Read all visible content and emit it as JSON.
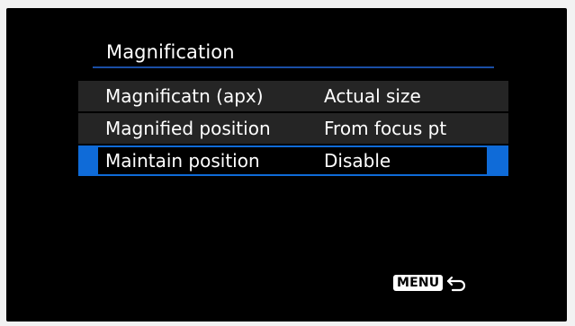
{
  "header": {
    "title": "Magnification"
  },
  "menu": {
    "items": [
      {
        "label": "Magnificatn (apx)",
        "value": "Actual size"
      },
      {
        "label": "Magnified position",
        "value": "From focus pt"
      },
      {
        "label": "Maintain position",
        "value": "Disable",
        "selected": true
      }
    ]
  },
  "footer": {
    "menu_button_label": "MENU",
    "return_icon": "return-arrow-icon"
  },
  "colors": {
    "background": "#000000",
    "highlight": "#0f6bd8",
    "row_background": "#252525",
    "title_underline": "#1a4ea5",
    "text": "#ffffff"
  }
}
